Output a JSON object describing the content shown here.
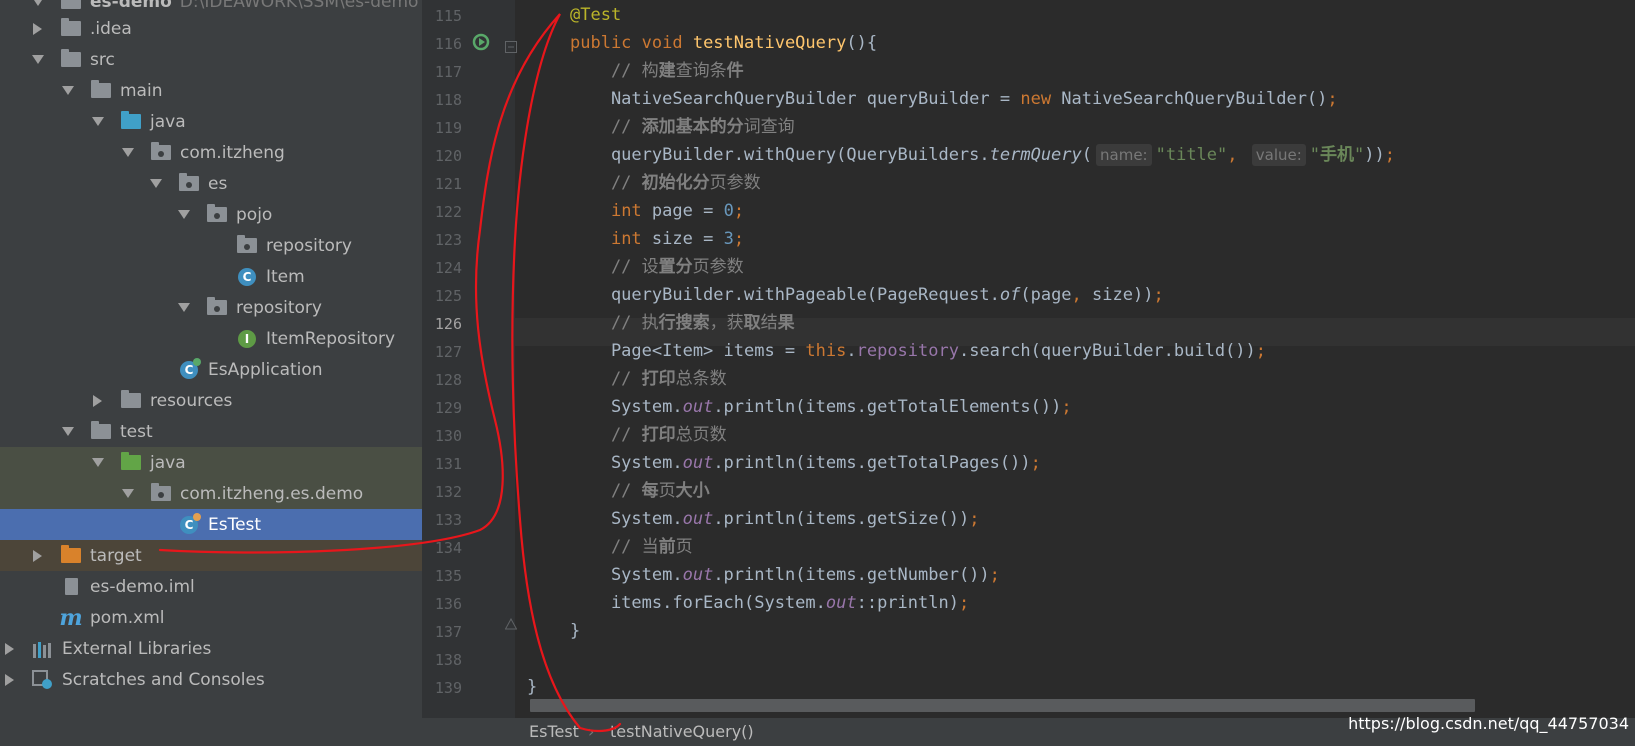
{
  "project_tree": {
    "root": {
      "label": "es-demo",
      "path": "D:\\IDEAWORK\\SSM\\es-demo"
    },
    "items": [
      {
        "label": ".idea"
      },
      {
        "label": "src"
      },
      {
        "label": "main"
      },
      {
        "label": "java"
      },
      {
        "label": "com.itzheng"
      },
      {
        "label": "es"
      },
      {
        "label": "pojo"
      },
      {
        "label": "repository"
      },
      {
        "label": "Item"
      },
      {
        "label": "repository"
      },
      {
        "label": "ItemRepository"
      },
      {
        "label": "EsApplication"
      },
      {
        "label": "resources"
      },
      {
        "label": "test"
      },
      {
        "label": "java"
      },
      {
        "label": "com.itzheng.es.demo"
      },
      {
        "label": "EsTest"
      },
      {
        "label": "target"
      },
      {
        "label": "es-demo.iml"
      },
      {
        "label": "pom.xml"
      },
      {
        "label": "External Libraries"
      },
      {
        "label": "Scratches and Consoles"
      }
    ]
  },
  "editor": {
    "line_numbers": [
      "115",
      "116",
      "117",
      "118",
      "119",
      "120",
      "121",
      "122",
      "123",
      "124",
      "125",
      "126",
      "127",
      "128",
      "129",
      "130",
      "131",
      "132",
      "133",
      "134",
      "135",
      "136",
      "137",
      "138",
      "139"
    ],
    "current_line": "126",
    "hints": {
      "name": "name:",
      "value": "value:"
    }
  },
  "breadcrumb": {
    "class_name": "EsTest",
    "method_name": "testNativeQuery()"
  },
  "watermark": "https://blog.csdn.net/qq_44757034",
  "colors": {
    "keyword": "#cc7832",
    "annotation": "#bbb529",
    "string": "#6a8759",
    "number": "#6897bb",
    "comment": "#808080",
    "selection": "#4b6eaf",
    "annotation_stroke": "#e8161b"
  }
}
